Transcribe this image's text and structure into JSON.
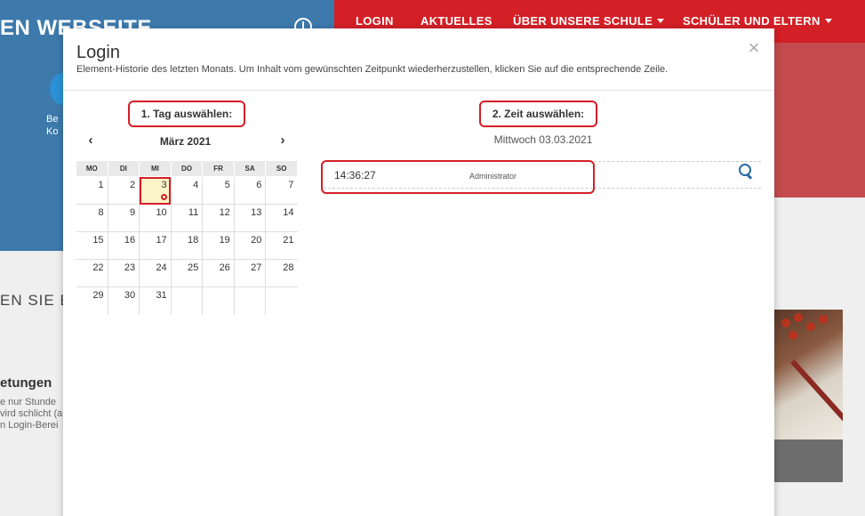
{
  "background": {
    "site_title": "EN WEBSEITE",
    "hero_text": [
      "Be",
      "Ko"
    ],
    "nav": [
      {
        "label": "LOGIN",
        "dropdown": false
      },
      {
        "label": "AKTUELLES",
        "dropdown": false
      },
      {
        "label": "ÜBER UNSERE SCHULE",
        "dropdown": true
      },
      {
        "label": "SCHÜLER UND ELTERN",
        "dropdown": true
      }
    ],
    "section_heading": "EN SIE E",
    "sub_heading": "etungen",
    "paragraph": [
      "e nur Stunde",
      "vird schlicht (a",
      "n Login-Berei"
    ],
    "colors": {
      "nav_red": "#d31f26",
      "hero_blue": "#3d79ab"
    }
  },
  "modal": {
    "title": "Login",
    "description": "Element-Historie des letzten Monats. Um Inhalt vom gewünschten Zeitpunkt wiederherzustellen, klicken Sie auf die entsprechende Zeile.",
    "close_label": "×",
    "step1_label": "1. Tag auswählen:",
    "step2_label": "2. Zeit auswählen:",
    "calendar": {
      "prev_label": "‹",
      "next_label": "›",
      "month_label": "März 2021",
      "weekdays": [
        "MO",
        "DI",
        "MI",
        "DO",
        "FR",
        "SA",
        "SO"
      ],
      "weeks": [
        [
          "1",
          "2",
          "3",
          "4",
          "5",
          "6",
          "7"
        ],
        [
          "8",
          "9",
          "10",
          "11",
          "12",
          "13",
          "14"
        ],
        [
          "15",
          "16",
          "17",
          "18",
          "19",
          "20",
          "21"
        ],
        [
          "22",
          "23",
          "24",
          "25",
          "26",
          "27",
          "28"
        ],
        [
          "29",
          "30",
          "31",
          "",
          "",
          "",
          ""
        ]
      ],
      "selected_day": "3"
    },
    "selected_date_label": "Mittwoch 03.03.2021",
    "entries": [
      {
        "time": "14:36:27",
        "user": "Administrator",
        "icon": "search-icon"
      }
    ]
  }
}
